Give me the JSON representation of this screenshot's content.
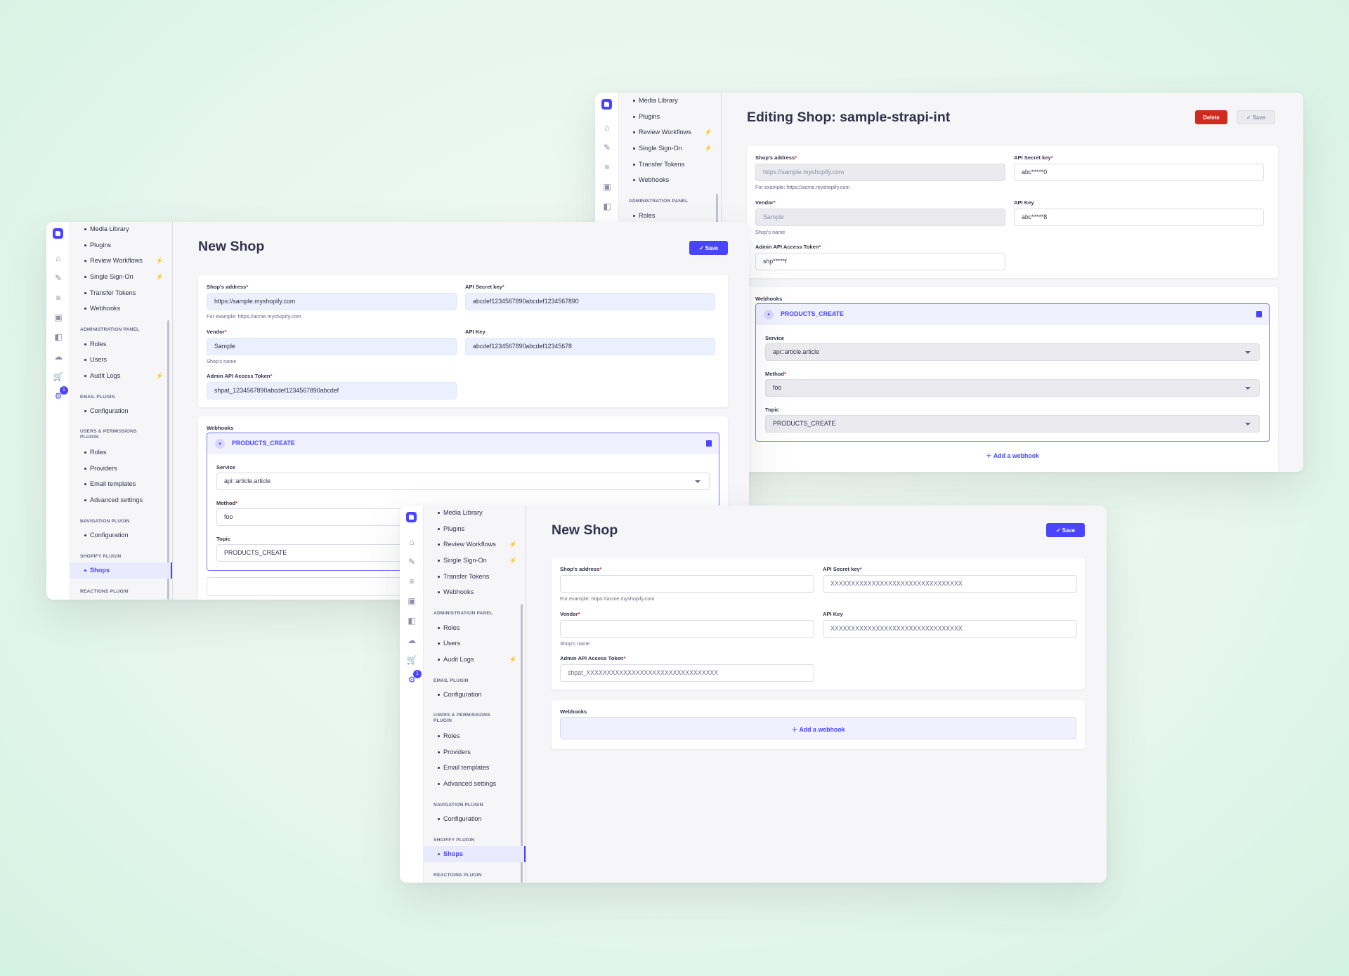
{
  "nav": {
    "items_top": [
      "Media Library",
      "Plugins",
      "Review Workflows",
      "Single Sign-On",
      "Transfer Tokens",
      "Webhooks"
    ],
    "admin_panel": {
      "title": "ADMINISTRATION PANEL",
      "items": [
        "Roles",
        "Users",
        "Audit Logs"
      ]
    },
    "email_plugin": {
      "title": "EMAIL PLUGIN",
      "items": [
        "Configuration"
      ]
    },
    "users_permissions": {
      "title": "USERS & PERMISSIONS PLUGIN",
      "items": [
        "Roles",
        "Providers",
        "Email templates",
        "Advanced settings"
      ]
    },
    "navigation_plugin": {
      "title": "NAVIGATION PLUGIN",
      "items": [
        "Configuration"
      ]
    },
    "shopify_plugin": {
      "title": "SHOPIFY PLUGIN",
      "items": [
        "Shops"
      ]
    },
    "reactions_plugin": {
      "title": "REACTIONS PLUGIN"
    },
    "settings_badge": "1"
  },
  "labels": {
    "shops_address": "Shop's address",
    "api_secret_key": "API Secret key",
    "vendor": "Vendor",
    "api_key": "API Key",
    "admin_token": "Admin API Access Token",
    "required_mark": "*",
    "webhooks": "Webhooks",
    "service": "Service",
    "method": "Method",
    "topic": "Topic",
    "address_hint": "For example: https://acme.myshopify.com",
    "vendor_hint": "Shop's name",
    "add_webhook": "Add a webhook",
    "save": "Save",
    "delete": "Delete"
  },
  "editing": {
    "title": "Editing Shop: sample-strapi-int",
    "address": "https://sample.myshopify.com",
    "secret": "abc*****0",
    "vendor": "Sample",
    "api_key": "abc*****8",
    "token": "shp*****f",
    "webhook": {
      "name": "PRODUCTS_CREATE",
      "service": "api::article.article",
      "method": "foo",
      "topic": "PRODUCTS_CREATE"
    }
  },
  "new_filled": {
    "title": "New Shop",
    "address": "https://sample.myshopify.com",
    "secret": "abcdef1234567890abcdef1234567890",
    "vendor": "Sample",
    "api_key": "abcdef1234567890abcdef12345678",
    "token": "shpat_1234567890abcdef1234567890abcdef",
    "webhook": {
      "name": "PRODUCTS_CREATE",
      "service": "api::article.article",
      "method": "foo",
      "topic": "PRODUCTS_CREATE"
    }
  },
  "new_empty": {
    "title": "New Shop",
    "address": "",
    "secret_placeholder": "XXXXXXXXXXXXXXXXXXXXXXXXXXXXXXXX",
    "vendor": "",
    "api_key_placeholder": "XXXXXXXXXXXXXXXXXXXXXXXXXXXXXXXX",
    "token_placeholder": "shpat_XXXXXXXXXXXXXXXXXXXXXXXXXXXXXXXX"
  },
  "icons": [
    "home-icon",
    "feather-icon",
    "list-icon",
    "media-icon",
    "layout-icon",
    "cloud-icon",
    "cart-icon",
    "settings-icon"
  ],
  "colors": {
    "primary": "#4945ff",
    "danger": "#d02b20",
    "accent_bolt": "#f29d41"
  }
}
